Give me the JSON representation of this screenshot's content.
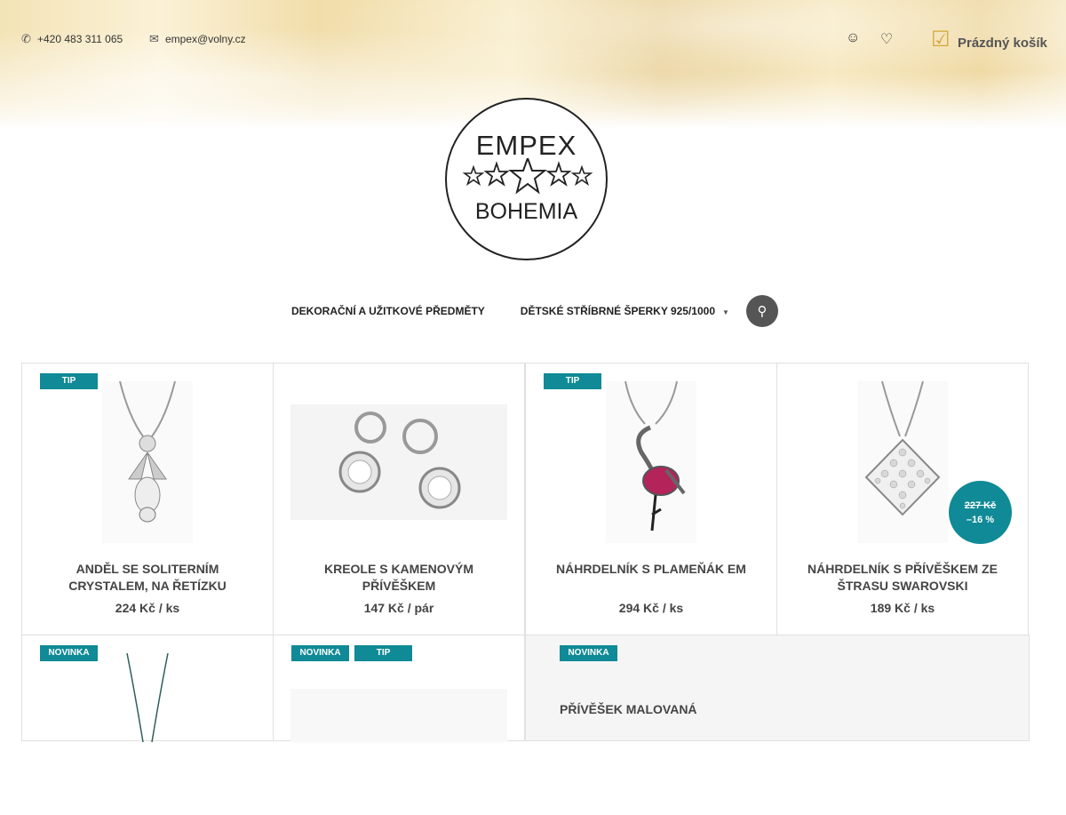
{
  "topbar": {
    "phone": "+420 483 311 065",
    "email": "empex@volny.cz",
    "cart_label": "Prázdný košík",
    "icons": [
      "phone-icon",
      "mail-icon",
      "user-icon",
      "heart-icon",
      "cart-icon"
    ]
  },
  "logo": {
    "line1": "EMPEX",
    "line2": "BOHEMIA"
  },
  "nav": {
    "items": [
      {
        "label": "DEKORAČNÍ A UŽITKOVÉ PŘEDMĚTY"
      },
      {
        "label": "DĚTSKÉ STŘÍBRNÉ ŠPERKY 925/1000"
      }
    ],
    "search_icon": "search-icon"
  },
  "products": [
    {
      "badges": [
        "TIP"
      ],
      "name": "ANDĚL SE SOLITERNÍM CRYSTALEM, NA ŘETÍZKU",
      "price": "224 Kč / ks"
    },
    {
      "badges": [],
      "name": "KREOLE S KAMENOVÝM PŘÍVĚŠKEM",
      "price": "147 Kč / pár"
    },
    {
      "badges": [
        "TIP"
      ],
      "name": "NÁHRDELNÍK S PLAMEŇÁK EM",
      "price": "294 Kč / ks"
    },
    {
      "badges": [],
      "name": "NÁHRDELNÍK S PŘÍVĚŠKEM ZE ŠTRASU SWAROVSKI",
      "price": "189 Kč / ks",
      "discount": {
        "old_price": "227 Kč",
        "percent": "–16 %"
      }
    },
    {
      "badges": [
        "NOVINKA"
      ],
      "name": "",
      "price": ""
    },
    {
      "badges": [
        "NOVINKA",
        "TIP"
      ],
      "name": "",
      "price": ""
    },
    {
      "badges": [
        "NOVINKA"
      ],
      "name": "PŘÍVĚŠEK MALOVANÁ",
      "price": ""
    }
  ],
  "colors": {
    "accent": "#0f8a96",
    "gold": "#d4a73b",
    "nav_search_bg": "#555555"
  }
}
